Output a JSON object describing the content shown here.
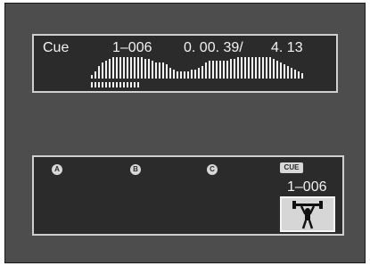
{
  "top_panel": {
    "mode_label": "Cue",
    "track_number": "1–006",
    "elapsed_time": "0. 00. 39/",
    "total_time": "4. 13"
  },
  "bottom_panel": {
    "hotcue_a": "A",
    "hotcue_b": "B",
    "hotcue_c": "C",
    "cue_badge": "CUE",
    "cue_track_number": "1–006",
    "thumbnail_icon": "weightlifter-icon"
  },
  "waveform": {
    "heights": [
      2,
      4,
      7,
      9,
      10,
      11,
      12,
      12,
      12,
      12,
      12,
      12,
      12,
      12,
      12,
      11,
      11,
      10,
      9,
      9,
      9,
      8,
      6,
      5,
      4,
      4,
      4,
      4,
      5,
      5,
      6,
      7,
      9,
      10,
      10,
      10,
      10,
      10,
      10,
      11,
      11,
      12,
      12,
      12,
      12,
      12,
      12,
      12,
      12,
      12,
      12,
      11,
      10,
      9,
      8,
      7,
      6,
      5,
      4,
      3
    ],
    "progress": 0.16
  },
  "colors": {
    "screen_bg": "#4d4d4d",
    "panel_bg": "#2b2b2b",
    "text": "#f2f2f2"
  }
}
